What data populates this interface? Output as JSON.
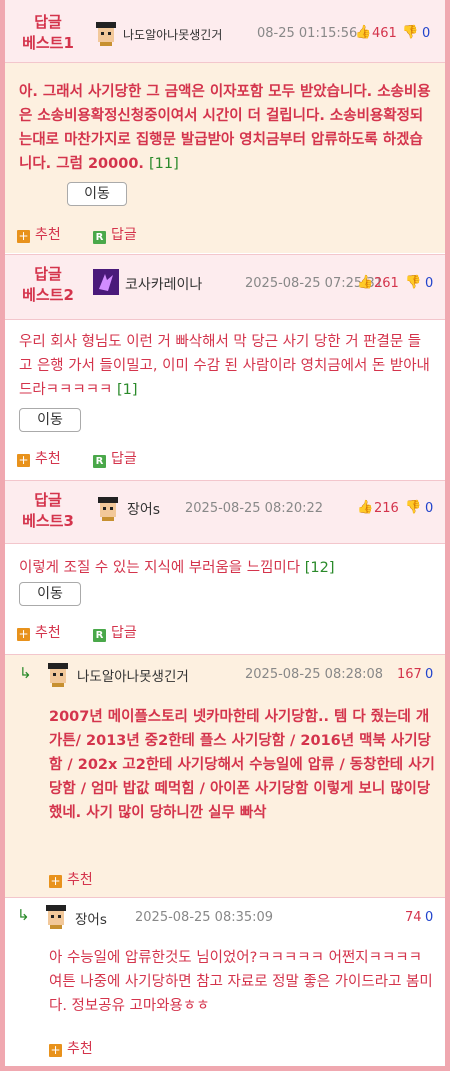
{
  "best_comments": [
    {
      "rank_line1": "답글",
      "rank_line2": "베스트1",
      "nickname": "나도알아나못생긴거",
      "date": "08-25 01:15:56",
      "up": "461",
      "down": "0",
      "text": "아. 그래서 사기당한 그 금액은 이자포함 모두 받았습니다. 소송비용은 소송비용확정신청중이여서 시간이 더 걸립니다. 소송비용확정되는대로 마찬가지로 집행문 발급받아 영치금부터 압류하도록 하겠습니다. 그럼 20000.",
      "ref": "[11]",
      "move": "이동",
      "recommend": "추천",
      "reply": "답글"
    },
    {
      "rank_line1": "답글",
      "rank_line2": "베스트2",
      "nickname": "코사카레이나",
      "date": "2025-08-25 07:25:31",
      "up": "261",
      "down": "0",
      "text": "우리 회사 형님도 이런 거 빠삭해서 막 당근 사기 당한 거 판결문 들고 은행 가서 들이밀고, 이미 수감 된 사람이라 영치금에서 돈 받아내드라ㅋㅋㅋㅋㅋ",
      "ref": "[1]",
      "move": "이동",
      "recommend": "추천",
      "reply": "답글"
    },
    {
      "rank_line1": "답글",
      "rank_line2": "베스트3",
      "nickname": "장어s",
      "date": "2025-08-25 08:20:22",
      "up": "216",
      "down": "0",
      "text": "이렇게 조질 수 있는 지식에 부러움을 느낌미다",
      "ref": "[12]",
      "move": "이동",
      "recommend": "추천",
      "reply": "답글"
    }
  ],
  "replies": [
    {
      "nickname": "나도알아나못생긴거",
      "date": "2025-08-25 08:28:08",
      "up": "167",
      "down": "0",
      "text": "2007년 메이플스토리 넷카마한테 사기당함.. 템 다 줬는데 개가튼/ 2013년 중2한테 플스 사기당함 / 2016년 맥북 사기당함 / 202x 고2한테 사기당해서 수능일에 압류 / 동창한테 사기당함 / 엄마 밥값 떼먹힘 / 아이폰 사기당함 이렇게 보니 많이당했네. 사기 많이 당하니깐 실무 빠삭",
      "recommend": "추천"
    },
    {
      "nickname": "장어s",
      "date": "2025-08-25 08:35:09",
      "up": "74",
      "down": "0",
      "text": "아 수능일에 압류한것도 님이었어?ㅋㅋㅋㅋㅋ 어쩐지ㅋㅋㅋㅋ 여튼 나중에 사기당하면 참고 자료로 정말 좋은 가이드라고 봄미다. 정보공유 고마와용ㅎㅎ",
      "recommend": "추천"
    }
  ],
  "colors": {
    "accent": "#d4344c",
    "border": "#f0a8b0",
    "header_bg": "#fdecee",
    "highlight_bg": "#fdf0e0",
    "link_green": "#2a8a2a",
    "down_blue": "#2244cc"
  },
  "icons": {
    "thumb_up": "thumbs-up-icon",
    "thumb_down": "thumbs-down-icon",
    "recommend": "plus-square-icon",
    "reply": "reply-r-icon",
    "reply_arrow": "reply-arrow-icon"
  }
}
